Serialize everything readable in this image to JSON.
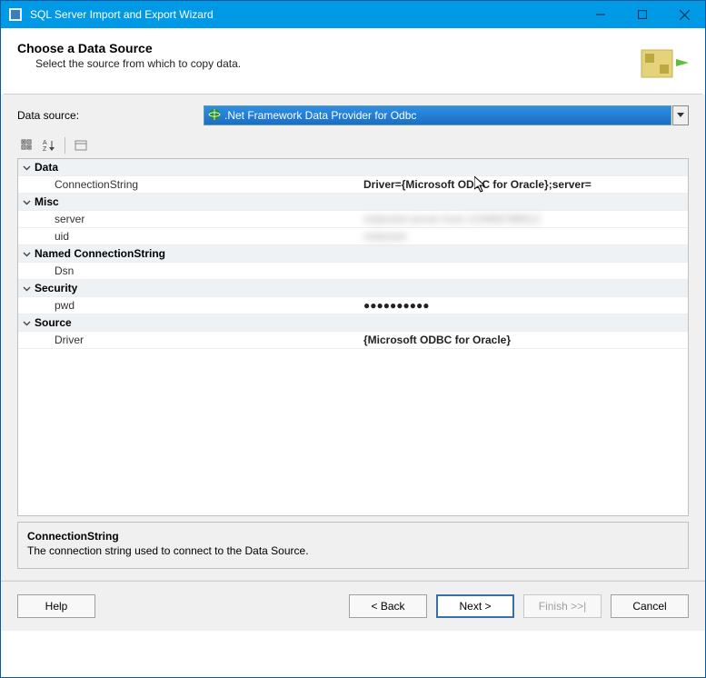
{
  "window": {
    "title": "SQL Server Import and Export Wizard"
  },
  "header": {
    "title": "Choose a Data Source",
    "subtitle": "Select the source from which to copy data."
  },
  "dataSource": {
    "label": "Data source:",
    "selected": ".Net Framework Data Provider for Odbc"
  },
  "propgrid": {
    "categories": [
      {
        "name": "Data",
        "props": [
          {
            "key": "ConnectionString",
            "value": "Driver={Microsoft ODBC for Oracle};server=",
            "bold": true,
            "fade": true,
            "cursor": true
          }
        ]
      },
      {
        "name": "Misc",
        "props": [
          {
            "key": "server",
            "value": "redacted-server-host 123456789012",
            "blur": true
          },
          {
            "key": "uid",
            "value": "redacted",
            "blur": true
          }
        ]
      },
      {
        "name": "Named ConnectionString",
        "props": [
          {
            "key": "Dsn",
            "value": ""
          }
        ]
      },
      {
        "name": "Security",
        "props": [
          {
            "key": "pwd",
            "value": "●●●●●●●●●●",
            "bold": true
          }
        ]
      },
      {
        "name": "Source",
        "props": [
          {
            "key": "Driver",
            "value": "{Microsoft ODBC for Oracle}",
            "bold": true
          }
        ]
      }
    ]
  },
  "description": {
    "title": "ConnectionString",
    "text": "The connection string used to connect to the Data Source."
  },
  "footer": {
    "help": "Help",
    "back": "< Back",
    "next": "Next >",
    "finish": "Finish >>|",
    "cancel": "Cancel"
  }
}
